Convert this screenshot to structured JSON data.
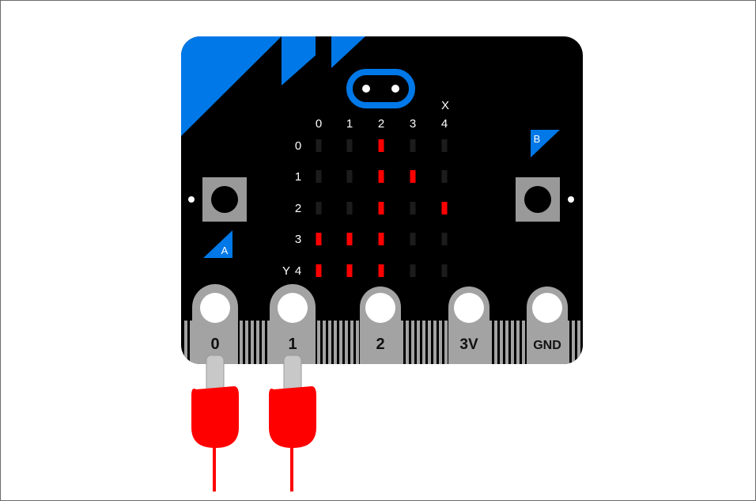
{
  "board": {
    "name": "micro:bit",
    "colors": {
      "body": "#000000",
      "accent": "#0078e7",
      "led_on": "#ff0000",
      "led_off": "#1c1c1c",
      "button_face": "#999999",
      "pad": "#a3a3a3",
      "clip": "#ff0000",
      "clip_stem": "#c8c8c8"
    },
    "axis": {
      "x_label": "X",
      "y_label": "Y",
      "columns": [
        "0",
        "1",
        "2",
        "3",
        "4"
      ],
      "rows": [
        "0",
        "1",
        "2",
        "3",
        "4"
      ]
    },
    "leds": [
      [
        0,
        0,
        1,
        0,
        0
      ],
      [
        0,
        0,
        1,
        1,
        0
      ],
      [
        0,
        0,
        1,
        0,
        1
      ],
      [
        1,
        1,
        1,
        0,
        0
      ],
      [
        1,
        1,
        1,
        0,
        0
      ]
    ],
    "buttons": {
      "a_label": "A",
      "b_label": "B"
    },
    "pins": [
      "0",
      "1",
      "2",
      "3V",
      "GND"
    ],
    "clips_on_pins": [
      "0",
      "1"
    ],
    "clip_icon": "alligator-clip-icon",
    "logo_icon": "microbit-logo-icon"
  }
}
